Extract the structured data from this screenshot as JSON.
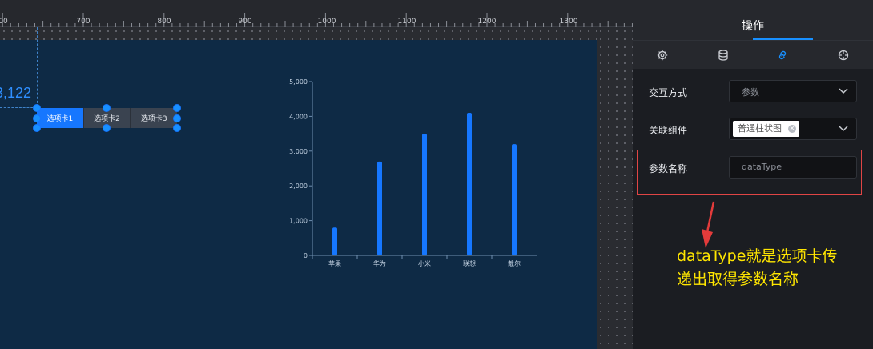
{
  "ruler": {
    "labels": [
      "00",
      "700",
      "800",
      "900",
      "1000",
      "1100",
      "1200",
      "1300"
    ]
  },
  "canvas": {
    "big_number": "3,122",
    "tabs": [
      "选项卡1",
      "选项卡2",
      "选项卡3"
    ],
    "active_tab": 0
  },
  "chart_data": {
    "type": "bar",
    "categories": [
      "苹果",
      "华为",
      "小米",
      "联想",
      "戴尔"
    ],
    "values": [
      800,
      2700,
      3500,
      4100,
      3200
    ],
    "ylim": [
      0,
      5000
    ],
    "yticks": [
      "0",
      "1,000",
      "2,000",
      "3,000",
      "4,000",
      "5,000"
    ],
    "title": "",
    "xlabel": "",
    "ylabel": "",
    "bar_color": "#1677ff",
    "grid": false
  },
  "panel": {
    "title": "操作",
    "icons": [
      "gear-icon",
      "database-icon",
      "link-icon",
      "target-icon"
    ],
    "active_icon": 2,
    "rows": {
      "interaction_label": "交互方式",
      "interaction_value": "参数",
      "linked_label": "关联组件",
      "linked_chip": "普通柱状图",
      "param_label": "参数名称",
      "param_placeholder": "dataType"
    }
  },
  "annotation": {
    "line1": "dataType就是选项卡传",
    "line2": "递出取得参数名称",
    "color": "#ffe600"
  }
}
